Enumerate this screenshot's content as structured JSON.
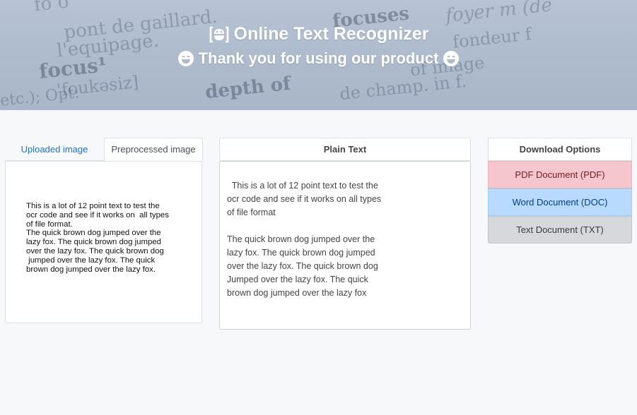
{
  "banner": {
    "title": "Online Text Recognizer",
    "subtitle": "Thank you for using our product",
    "title_icon": "ocr-scan-icon",
    "subtitle_icon": "smile-icon",
    "background_words": [
      "fo o",
      "pont de gaillard.",
      "l'equipage.",
      "focus¹",
      "'foukəsiz]",
      "depth of",
      "focuses",
      "foyer m (de",
      "fondeur f",
      "of image",
      "de champ. in f.",
      "etc.); Opt:"
    ]
  },
  "tabs": {
    "uploaded": "Uploaded image",
    "preprocessed": "Preprocessed image"
  },
  "image_text": "This is a lot of 12 point text to test the\nocr code and see if it works on  all types\nof file format.\nThe quick brown dog jumped over the\nlazy fox. The quick brown dog jumped\nover the lazy fox. The quick brown dog\n jumped over the lazy fox. The quick\nbrown dog jumped over the lazy fox.",
  "plain_text": {
    "header": "Plain Text",
    "content": "This is a lot of 12 point text to test the\nocr code and see if it works on all types\nof file format\n\nThe quick brown dog jumped over the\nlazy fox. The quick brown dog jumped\nover the lazy fox. The quick brown dog\nJumped over the lazy fox. The quick\nbrown dog jumped over the lazy fox"
  },
  "download": {
    "header": "Download Options",
    "pdf": "PDF Document (PDF)",
    "doc": "Word Document (DOC)",
    "txt": "Text Document (TXT)"
  },
  "colors": {
    "banner": "#aebbcd",
    "tab_active_link": "#1a73c8",
    "pdf_bg": "#f5c6cb",
    "doc_bg": "#b8daff",
    "txt_bg": "#d6d8db"
  }
}
